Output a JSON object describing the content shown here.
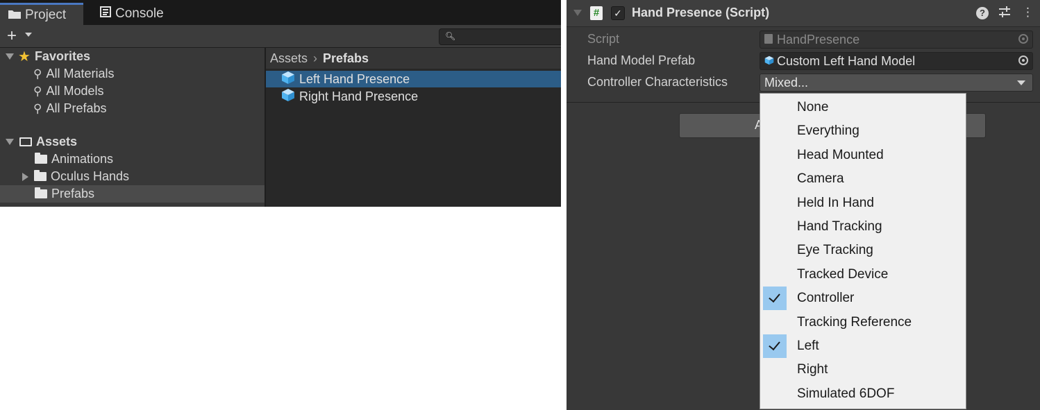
{
  "project": {
    "tabs": [
      {
        "label": "Project",
        "icon": "folder-icon",
        "active": true
      },
      {
        "label": "Console",
        "icon": "console-icon",
        "active": false
      }
    ],
    "toolbar": {
      "add_label": "+",
      "search_placeholder": ""
    },
    "favorites": {
      "label": "Favorites",
      "items": [
        {
          "label": "All Materials"
        },
        {
          "label": "All Models"
        },
        {
          "label": "All Prefabs"
        }
      ]
    },
    "assets": {
      "label": "Assets",
      "items": [
        {
          "label": "Animations",
          "expandable": false
        },
        {
          "label": "Oculus Hands",
          "expandable": true
        },
        {
          "label": "Prefabs",
          "expandable": false,
          "selected": true
        }
      ]
    },
    "breadcrumb": {
      "root": "Assets",
      "current": "Prefabs"
    },
    "content_items": [
      {
        "label": "Left Hand Presence",
        "selected": true
      },
      {
        "label": "Right Hand Presence",
        "selected": false
      }
    ]
  },
  "inspector": {
    "component_title": "Hand Presence (Script)",
    "enabled": true,
    "properties": {
      "script": {
        "label": "Script",
        "value": "HandPresence"
      },
      "hand_model_prefab": {
        "label": "Hand Model Prefab",
        "value": "Custom Left Hand Model"
      },
      "controller_characteristics": {
        "label": "Controller Characteristics",
        "value": "Mixed..."
      }
    },
    "hidden_button_label": "A"
  },
  "flags_popup": {
    "options": [
      {
        "label": "None",
        "checked": false
      },
      {
        "label": "Everything",
        "checked": false
      },
      {
        "label": "Head Mounted",
        "checked": false
      },
      {
        "label": "Camera",
        "checked": false
      },
      {
        "label": "Held In Hand",
        "checked": false
      },
      {
        "label": "Hand Tracking",
        "checked": false
      },
      {
        "label": "Eye Tracking",
        "checked": false
      },
      {
        "label": "Tracked Device",
        "checked": false
      },
      {
        "label": "Controller",
        "checked": true
      },
      {
        "label": "Tracking Reference",
        "checked": false
      },
      {
        "label": "Left",
        "checked": true
      },
      {
        "label": "Right",
        "checked": false
      },
      {
        "label": "Simulated 6DOF",
        "checked": false
      }
    ]
  },
  "colors": {
    "selection_blue": "#2c5d87",
    "tab_accent": "#4a78c2",
    "check_highlight": "#99c9ef",
    "favorite_star": "#f2c233"
  }
}
